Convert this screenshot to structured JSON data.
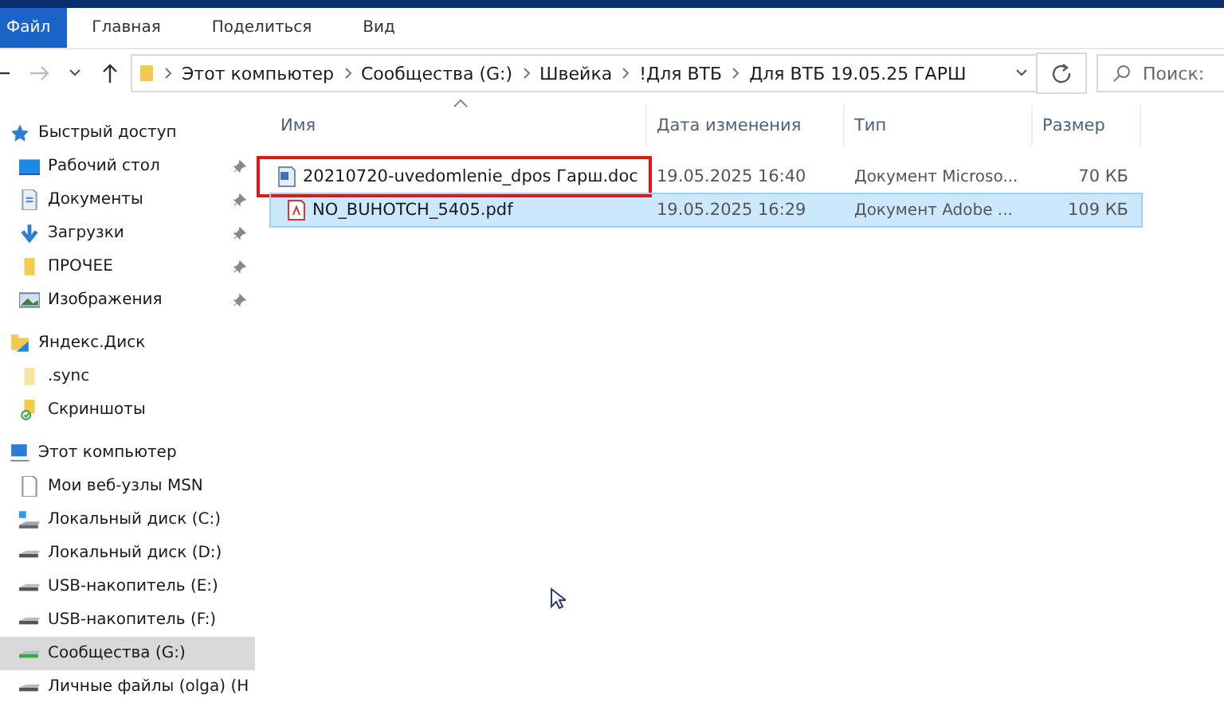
{
  "ribbon": {
    "tabs": [
      {
        "label": "Файл",
        "selected": true
      },
      {
        "label": "Главная",
        "selected": false
      },
      {
        "label": "Поделиться",
        "selected": false
      },
      {
        "label": "Вид",
        "selected": false
      }
    ]
  },
  "address_bar": {
    "path": [
      "Этот компьютер",
      "Сообщества (G:)",
      "Швейка",
      "!Для ВТБ",
      "Для ВТБ 19.05.25 ГАРШ"
    ]
  },
  "search": {
    "placeholder": "Поиск:"
  },
  "sidebar": {
    "items": [
      {
        "kind": "section",
        "label": "Быстрый доступ",
        "pinned": false,
        "selected": false
      },
      {
        "kind": "item",
        "label": "Рабочий стол",
        "pinned": true,
        "selected": false
      },
      {
        "kind": "item",
        "label": "Документы",
        "pinned": true,
        "selected": false
      },
      {
        "kind": "item",
        "label": "Загрузки",
        "pinned": true,
        "selected": false
      },
      {
        "kind": "item",
        "label": "ПРОЧЕЕ",
        "pinned": true,
        "selected": false
      },
      {
        "kind": "item",
        "label": "Изображения",
        "pinned": true,
        "selected": false
      },
      {
        "kind": "section",
        "label": "Яндекс.Диск",
        "pinned": false,
        "selected": false
      },
      {
        "kind": "item",
        "label": ".sync",
        "pinned": false,
        "selected": false
      },
      {
        "kind": "item",
        "label": "Скриншоты",
        "pinned": false,
        "selected": false
      },
      {
        "kind": "section",
        "label": "Этот компьютер",
        "pinned": false,
        "selected": false
      },
      {
        "kind": "item",
        "label": "Мои веб-узлы MSN",
        "pinned": false,
        "selected": false
      },
      {
        "kind": "item",
        "label": "Локальный диск (C:)",
        "pinned": false,
        "selected": false
      },
      {
        "kind": "item",
        "label": "Локальный диск (D:)",
        "pinned": false,
        "selected": false
      },
      {
        "kind": "item",
        "label": "USB-накопитель (E:)",
        "pinned": false,
        "selected": false
      },
      {
        "kind": "item",
        "label": "USB-накопитель (F:)",
        "pinned": false,
        "selected": false
      },
      {
        "kind": "item",
        "label": "Сообщества (G:)",
        "pinned": false,
        "selected": true
      },
      {
        "kind": "item",
        "label": "Личные файлы (olga) (H",
        "pinned": false,
        "selected": false
      }
    ]
  },
  "table": {
    "columns": [
      "Имя",
      "Дата изменения",
      "Тип",
      "Размер"
    ],
    "rows": [
      {
        "kind": "doc",
        "name": "20210720-uvedomlenie_dpos Гарш.doc",
        "date": "19.05.2025 16:40",
        "type": "Документ Microso...",
        "size": "70 КБ",
        "selected": false,
        "outlined": true
      },
      {
        "kind": "pdf",
        "name": "NO_BUHOTCH_5405.pdf",
        "date": "19.05.2025 16:29",
        "type": "Документ Adobe ...",
        "size": "109 КБ",
        "selected": true,
        "outlined": false
      }
    ]
  }
}
